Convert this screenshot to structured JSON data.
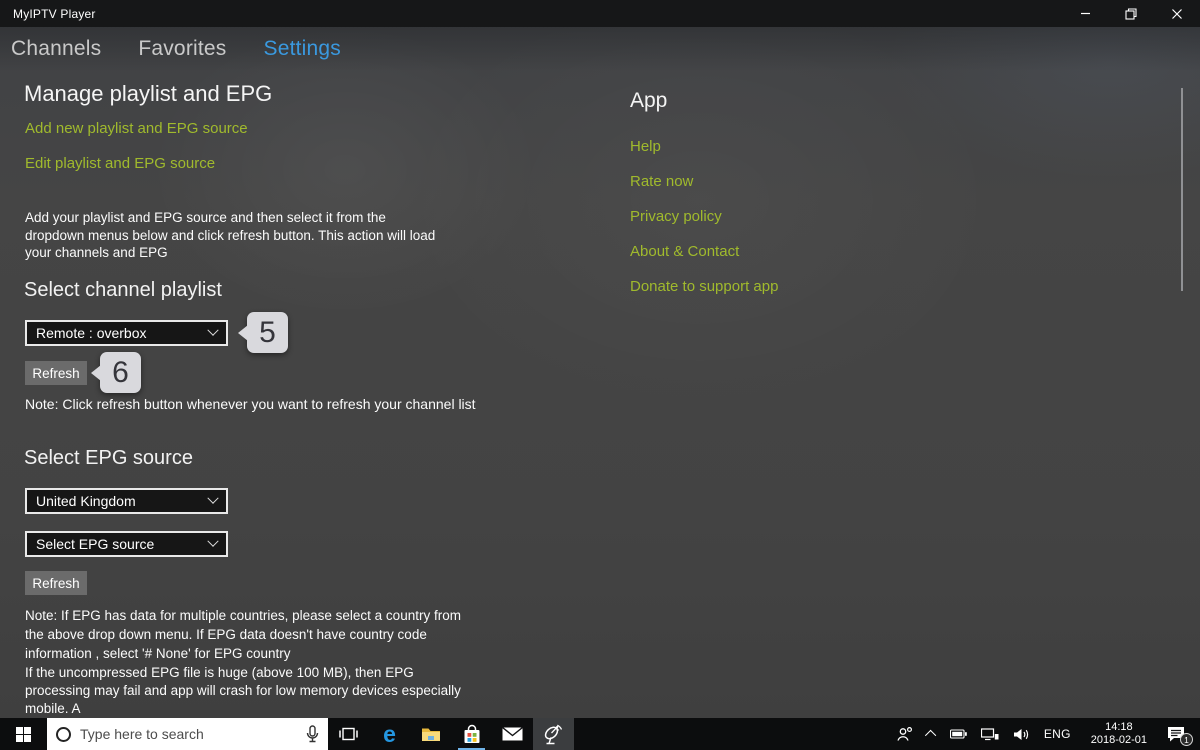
{
  "window": {
    "title": "MyIPTV Player"
  },
  "tabs": [
    {
      "label": "Channels",
      "active": false
    },
    {
      "label": "Favorites",
      "active": false
    },
    {
      "label": "Settings",
      "active": true
    }
  ],
  "manage": {
    "heading": "Manage playlist and EPG",
    "add_link": "Add new playlist and EPG source",
    "edit_link": "Edit playlist and EPG source",
    "description": "Add your playlist and EPG source and then select it from the dropdown menus below and click refresh button. This action will load your channels and EPG"
  },
  "channel_playlist": {
    "heading": "Select channel playlist",
    "dropdown_value": "Remote : overbox",
    "refresh_label": "Refresh",
    "callout_dropdown": "5",
    "callout_refresh": "6",
    "note": "Note: Click refresh button whenever you want to refresh your channel list"
  },
  "epg": {
    "heading": "Select EPG source",
    "country_dropdown_value": "United Kingdom",
    "source_dropdown_value": "Select EPG source",
    "refresh_label": "Refresh",
    "note_country": "Note:  If EPG has data for multiple countries, please select a country from the above drop down menu. If EPG  data doesn't have country code information , select '# None' for EPG country",
    "note_size": "If the uncompressed EPG file is huge (above 100 MB), then EPG processing may fail and app will crash for low memory devices especially mobile. A"
  },
  "app_section": {
    "heading": "App",
    "links": [
      "Help",
      "Rate now",
      "Privacy policy",
      "About & Contact",
      "Donate to support app"
    ]
  },
  "taskbar": {
    "search_placeholder": "Type here to search",
    "icons": [
      "start",
      "task-view",
      "edge",
      "file-explorer",
      "store",
      "mail",
      "myiptv-satellite-dish"
    ],
    "language": "ENG",
    "time": "14:18",
    "date": "2018-02-01",
    "notification_count": "1"
  },
  "colors": {
    "accent_green": "#a0ba2d",
    "accent_blue": "#3a99df",
    "taskbar_underline": "#5ca3de",
    "background": "#434343"
  }
}
